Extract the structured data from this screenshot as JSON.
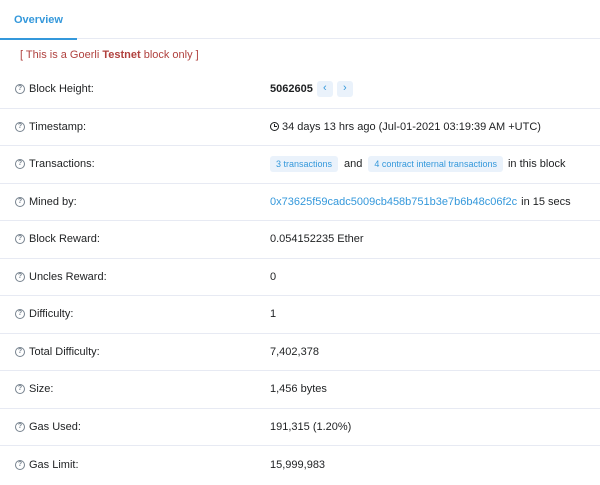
{
  "tabs": {
    "overview": "Overview"
  },
  "notice": {
    "prefix": "[ This is a Goerli ",
    "bold": "Testnet",
    "suffix": " block only ]"
  },
  "rows": {
    "block_height": {
      "label": "Block Height:",
      "value": "5062605",
      "prev": "‹",
      "next": "›"
    },
    "timestamp": {
      "label": "Timestamp:",
      "value": "34 days 13 hrs ago (Jul-01-2021 03:19:39 AM +UTC)"
    },
    "transactions": {
      "label": "Transactions:",
      "tx": "3 transactions",
      "and": "and",
      "internal": "4 contract internal transactions",
      "suffix": "in this block"
    },
    "mined_by": {
      "label": "Mined by:",
      "address": "0x73625f59cadc5009cb458b751b3e7b6b48c06f2c",
      "suffix": "in 15 secs"
    },
    "block_reward": {
      "label": "Block Reward:",
      "value": "0.054152235 Ether"
    },
    "uncles_reward": {
      "label": "Uncles Reward:",
      "value": "0"
    },
    "difficulty": {
      "label": "Difficulty:",
      "value": "1"
    },
    "total_difficulty": {
      "label": "Total Difficulty:",
      "value": "7,402,378"
    },
    "size": {
      "label": "Size:",
      "value": "1,456 bytes"
    },
    "gas_used": {
      "label": "Gas Used:",
      "value": "191,315 (1.20%)"
    },
    "gas_limit": {
      "label": "Gas Limit:",
      "value": "15,999,983"
    }
  },
  "help_icon_glyph": "?"
}
